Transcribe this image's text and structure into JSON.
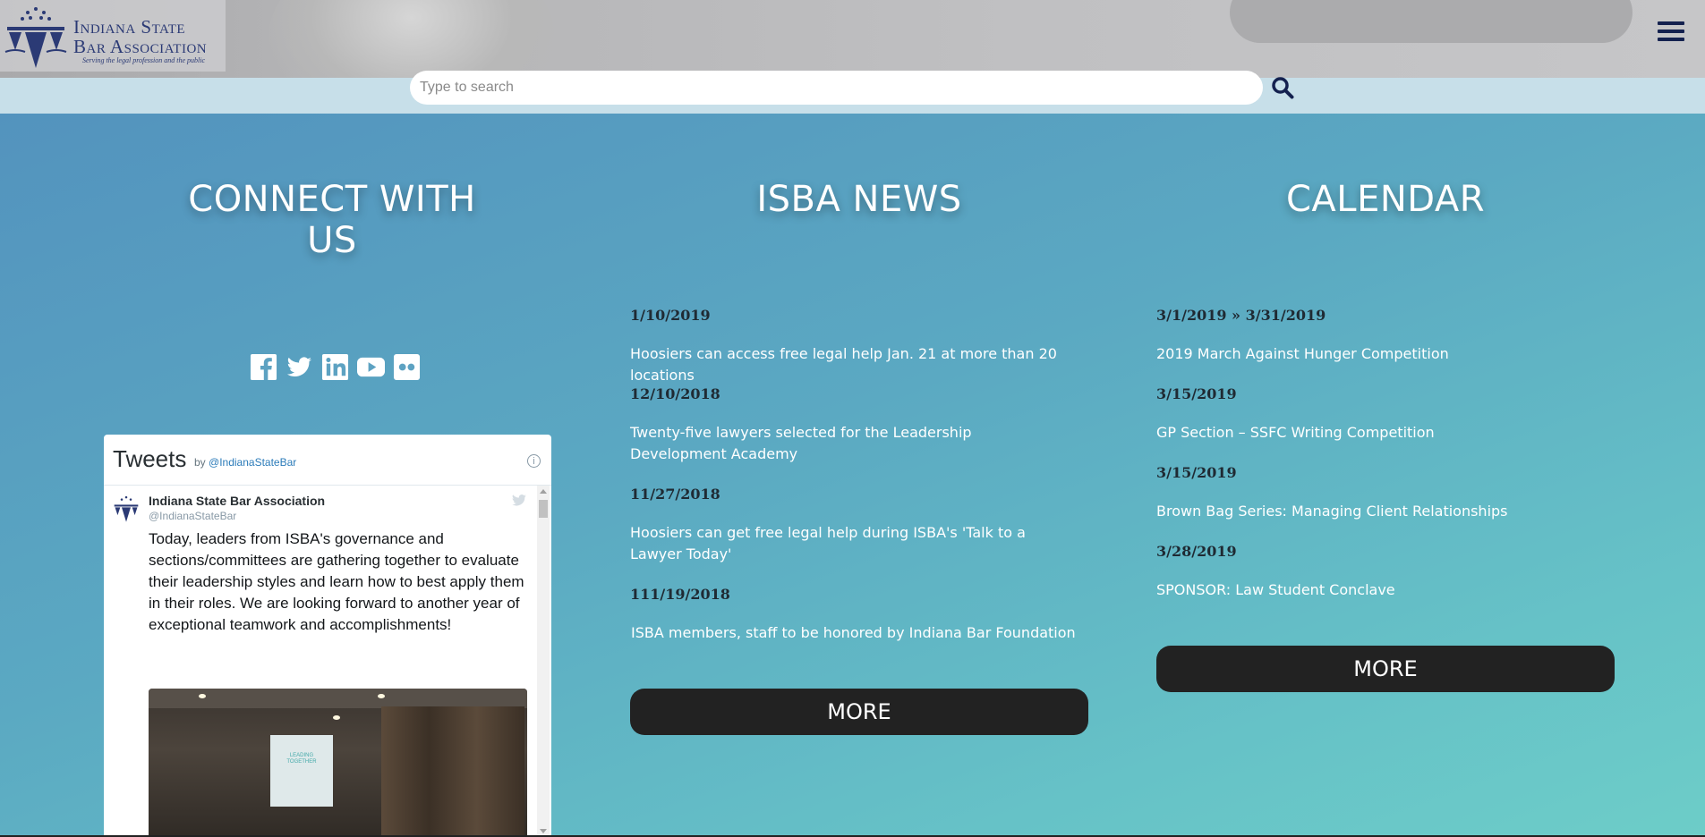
{
  "header": {
    "logo_line1": "Indiana State",
    "logo_line2": "Bar Association",
    "logo_tagline": "Serving the legal profession and the public",
    "menu_icon": "hamburger-menu-icon"
  },
  "search": {
    "placeholder": "Type to search",
    "icon": "search-icon"
  },
  "connect": {
    "title": "CONNECT WITH US",
    "social_icons": [
      "facebook-icon",
      "twitter-icon",
      "linkedin-icon",
      "youtube-icon",
      "flickr-icon"
    ]
  },
  "twitter_widget": {
    "title": "Tweets",
    "by": "by",
    "handle_link": "@IndianaStateBar",
    "info": "i",
    "tweet": {
      "author": "Indiana State Bar Association",
      "handle": "@IndianaStateBar",
      "text": "Today, leaders from ISBA's governance and sections/committees are gathering together to evaluate their leadership styles and learn how to best apply them in their roles. We are looking forward to another year of exceptional teamwork and accomplishments!",
      "photo_screen_text": "LEADING TOGETHER"
    }
  },
  "news": {
    "title": "ISBA NEWS",
    "items": [
      {
        "date": "1/10/2019",
        "headline": "Hoosiers can access free legal help Jan. 21 at more than 20 locations"
      },
      {
        "date": "12/10/2018",
        "headline": "Twenty-five lawyers selected for the Leadership Development Academy"
      },
      {
        "date": "11/27/2018",
        "headline": "Hoosiers can get free legal help during ISBA's 'Talk to a Lawyer Today'"
      },
      {
        "date": "111/19/2018",
        "headline": "ISBA members, staff to be honored by Indiana Bar Foundation"
      }
    ],
    "more_label": "MORE"
  },
  "calendar": {
    "title": "CALENDAR",
    "items": [
      {
        "date": "3/1/2019 » 3/31/2019",
        "event": "2019 March Against Hunger Competition"
      },
      {
        "date": "3/15/2019",
        "event": "GP Section – SSFC Writing Competition"
      },
      {
        "date": "3/15/2019",
        "event": "Brown Bag Series: Managing Client Relationships"
      },
      {
        "date": "3/28/2019",
        "event": "SPONSOR: Law Student Conclave"
      }
    ],
    "more_label": "MORE"
  },
  "colors": {
    "brand_navy": "#2b3a75",
    "button_dark": "#222222",
    "text_white": "#ffffff"
  }
}
